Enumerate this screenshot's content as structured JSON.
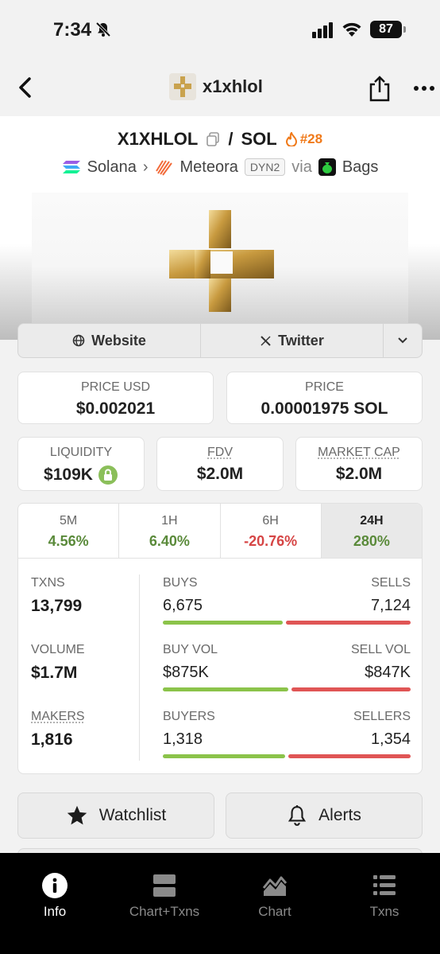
{
  "status_bar": {
    "time": "7:34",
    "battery": "87"
  },
  "nav": {
    "title": "x1xhlol"
  },
  "pair": {
    "base": "X1XHLOL",
    "separator": "/",
    "quote": "SOL",
    "rank": "#28",
    "chain": "Solana",
    "dex": "Meteora",
    "dex_tag": "DYN2",
    "via": "via",
    "launchpad": "Bags"
  },
  "links": {
    "website": "Website",
    "twitter": "Twitter"
  },
  "stats": {
    "price_usd_label": "PRICE USD",
    "price_usd": "$0.002021",
    "price_label": "PRICE",
    "price": "0.00001975 SOL",
    "liquidity_label": "LIQUIDITY",
    "liquidity": "$109K",
    "fdv_label": "FDV",
    "fdv": "$2.0M",
    "mcap_label": "MARKET CAP",
    "mcap": "$2.0M"
  },
  "timeframes": [
    {
      "label": "5M",
      "value": "4.56%",
      "trend": "up"
    },
    {
      "label": "1H",
      "value": "6.40%",
      "trend": "up"
    },
    {
      "label": "6H",
      "value": "-20.76%",
      "trend": "down"
    },
    {
      "label": "24H",
      "value": "280%",
      "trend": "up"
    }
  ],
  "txns": {
    "txns_label": "TXNS",
    "txns": "13,799",
    "volume_label": "VOLUME",
    "volume": "$1.7M",
    "makers_label": "MAKERS",
    "makers": "1,816",
    "buys_label": "BUYS",
    "buys": "6,675",
    "sells_label": "SELLS",
    "sells": "7,124",
    "buy_vol_label": "BUY VOL",
    "buy_vol": "$875K",
    "sell_vol_label": "SELL VOL",
    "sell_vol": "$847K",
    "buyers_label": "BUYERS",
    "buyers": "1,318",
    "sellers_label": "SELLERS",
    "sellers": "1,354",
    "buys_ratio": 0.484,
    "buy_vol_ratio": 0.508,
    "buyers_ratio": 0.493
  },
  "actions": {
    "watchlist": "Watchlist",
    "alerts": "Alerts"
  },
  "tabs": [
    {
      "label": "Info",
      "icon": "info-icon",
      "active": true
    },
    {
      "label": "Chart+Txns",
      "icon": "split-view-icon"
    },
    {
      "label": "Chart",
      "icon": "area-chart-icon"
    },
    {
      "label": "Txns",
      "icon": "list-icon"
    }
  ],
  "colors": {
    "positive": "#5a8a3a",
    "negative": "#d64545",
    "buy_bar": "#8bc34a",
    "sell_bar": "#e05555",
    "rank": "#f07a1a"
  }
}
